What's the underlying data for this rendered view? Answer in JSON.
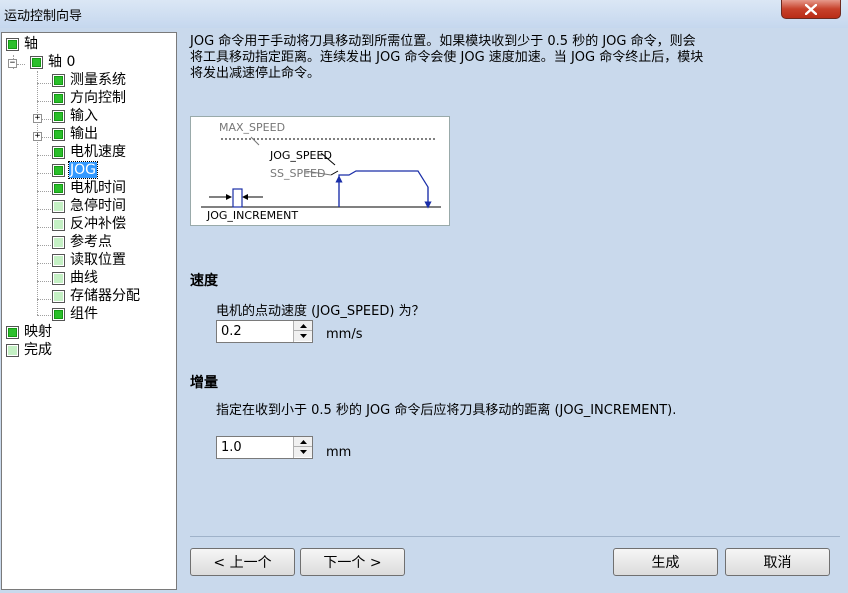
{
  "window": {
    "title": "运动控制向导"
  },
  "tree": {
    "items": [
      {
        "label": "轴",
        "state": "checked"
      },
      {
        "label": "轴 0",
        "state": "checked"
      },
      {
        "label": "测量系统",
        "state": "checked"
      },
      {
        "label": "方向控制",
        "state": "checked"
      },
      {
        "label": "输入",
        "state": "checked"
      },
      {
        "label": "输出",
        "state": "checked"
      },
      {
        "label": "电机速度",
        "state": "checked"
      },
      {
        "label": "JOG",
        "state": "checked",
        "selected": true
      },
      {
        "label": "电机时间",
        "state": "checked"
      },
      {
        "label": "急停时间",
        "state": "empty"
      },
      {
        "label": "反冲补偿",
        "state": "empty"
      },
      {
        "label": "参考点",
        "state": "empty"
      },
      {
        "label": "读取位置",
        "state": "empty"
      },
      {
        "label": "曲线",
        "state": "empty"
      },
      {
        "label": "存储器分配",
        "state": "empty"
      },
      {
        "label": "组件",
        "state": "checked"
      },
      {
        "label": "映射",
        "state": "checked"
      },
      {
        "label": "完成",
        "state": "empty"
      }
    ],
    "expander_minus": "−",
    "expander_plus": "+"
  },
  "description": {
    "line1": "JOG 命令用于手动将刀具移动到所需位置。如果模块收到少于 0.5 秒的 JOG 命令，则会",
    "line2": "将工具移动指定距离。连续发出 JOG 命令会使 JOG 速度加速。当 JOG 命令终止后，模块",
    "line3": "将发出减速停止命令。"
  },
  "diagram": {
    "max_speed": "MAX_SPEED",
    "jog_speed": "JOG_SPEED",
    "ss_speed": "SS_SPEED",
    "jog_increment": "JOG_INCREMENT"
  },
  "speed": {
    "title": "速度",
    "prompt": "电机的点动速度 (JOG_SPEED) 为？",
    "value": "0.2",
    "unit": "mm/s"
  },
  "increment": {
    "title": "增量",
    "prompt": "指定在收到小于 0.5 秒的 JOG 命令后应将刀具移动的距离 (JOG_INCREMENT).",
    "value": "1.0",
    "unit": "mm"
  },
  "buttons": {
    "prev": "< 上一个",
    "next": "下一个 >",
    "generate": "生成",
    "cancel": "取消"
  }
}
